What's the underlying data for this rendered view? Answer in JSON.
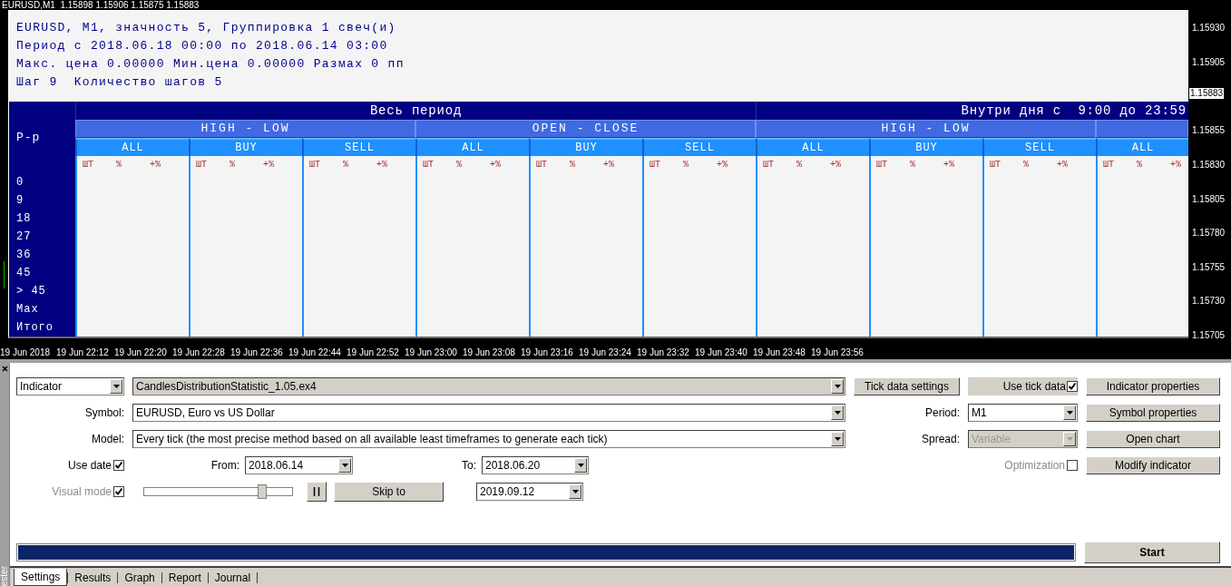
{
  "chart": {
    "symbol_line": "EURUSD,M1  1.15898 1.15906 1.15875 1.15883",
    "info_lines": [
      "EURUSD, M1, значность 5, Группировка 1 свеч(и)",
      "Период с 2018.06.18 00:00 по 2018.06.14 03:00",
      "Макс. цена 0.00000 Мин.цена 0.00000 Размах 0 пп",
      "Шаг 9  Количество шагов 5"
    ],
    "table": {
      "corner": "Р-р",
      "periods": [
        {
          "label": "Весь период",
          "groups": [
            {
              "label": "HIGH - LOW",
              "columns": [
                {
                  "label": "ALL",
                  "units": [
                    "ШТ",
                    "%",
                    "+%"
                  ]
                },
                {
                  "label": "BUY",
                  "units": [
                    "ШТ",
                    "%",
                    "+%"
                  ]
                },
                {
                  "label": "SELL",
                  "units": [
                    "ШТ",
                    "%",
                    "+%"
                  ]
                }
              ]
            },
            {
              "label": "OPEN - CLOSE",
              "columns": [
                {
                  "label": "ALL",
                  "units": [
                    "ШТ",
                    "%",
                    "+%"
                  ]
                },
                {
                  "label": "BUY",
                  "units": [
                    "ШТ",
                    "%",
                    "+%"
                  ]
                },
                {
                  "label": "SELL",
                  "units": [
                    "ШТ",
                    "%",
                    "+%"
                  ]
                }
              ]
            }
          ]
        },
        {
          "label": "Внутри дня с  9:00 до 23:59",
          "groups": [
            {
              "label": "HIGH - LOW",
              "columns": [
                {
                  "label": "ALL",
                  "units": [
                    "ШТ",
                    "%",
                    "+%"
                  ]
                },
                {
                  "label": "BUY",
                  "units": [
                    "ШТ",
                    "%",
                    "+%"
                  ]
                },
                {
                  "label": "SELL",
                  "units": [
                    "ШТ",
                    "%",
                    "+%"
                  ]
                }
              ]
            },
            {
              "columns": [
                {
                  "label": "ALL",
                  "units": [
                    "ШТ",
                    "%",
                    "+%"
                  ]
                }
              ]
            }
          ]
        }
      ],
      "row_labels": [
        "0",
        "9",
        "18",
        "27",
        "36",
        "45",
        "> 45",
        "Max",
        "Итого"
      ]
    },
    "price_labels": [
      "1.15930",
      "1.15905",
      "1.15855",
      "1.15830",
      "1.15805",
      "1.15780",
      "1.15755",
      "1.15730",
      "1.15705"
    ],
    "current_price": "1.15883",
    "time_labels": [
      "19 Jun 2018",
      "19 Jun 22:12",
      "19 Jun 22:20",
      "19 Jun 22:28",
      "19 Jun 22:36",
      "19 Jun 22:44",
      "19 Jun 22:52",
      "19 Jun 23:00",
      "19 Jun 23:08",
      "19 Jun 23:16",
      "19 Jun 23:24",
      "19 Jun 23:32",
      "19 Jun 23:40",
      "19 Jun 23:48",
      "19 Jun 23:56"
    ]
  },
  "tester": {
    "side_label": "ester",
    "type_select": "Indicator",
    "file_select": "CandlesDistributionStatistic_1.05.ex4",
    "tick_data_button": "Tick data settings",
    "use_tick_data": {
      "label": "Use tick data",
      "checked": true
    },
    "buttons": [
      "Indicator properties",
      "Symbol properties",
      "Open chart",
      "Modify indicator"
    ],
    "symbol": {
      "label": "Symbol:",
      "value": "EURUSD, Euro vs US Dollar"
    },
    "model": {
      "label": "Model:",
      "value": "Every tick (the most precise method based on all available least timeframes to generate each tick)"
    },
    "period": {
      "label": "Period:",
      "value": "M1"
    },
    "spread": {
      "label": "Spread:",
      "value": "Variable",
      "disabled": true
    },
    "use_date": {
      "label": "Use date",
      "checked": true
    },
    "from": {
      "label": "From:",
      "value": "2018.06.14"
    },
    "to": {
      "label": "To:",
      "value": "2018.06.20"
    },
    "optimization": {
      "label": "Optimization",
      "checked": false,
      "disabled": true
    },
    "visual_mode": {
      "label": "Visual mode",
      "checked": true,
      "disabled": true
    },
    "speed_slider": {
      "level": 0.8
    },
    "skip_button": "Skip to",
    "skip_date": "2019.09.12",
    "progress": {
      "level": 1
    },
    "start_button": "Start",
    "tabs": [
      {
        "label": "Settings",
        "selected": true
      },
      {
        "label": "Results",
        "selected": false
      },
      {
        "label": "Graph",
        "selected": false
      },
      {
        "label": "Report",
        "selected": false
      },
      {
        "label": "Journal",
        "selected": false
      }
    ]
  }
}
